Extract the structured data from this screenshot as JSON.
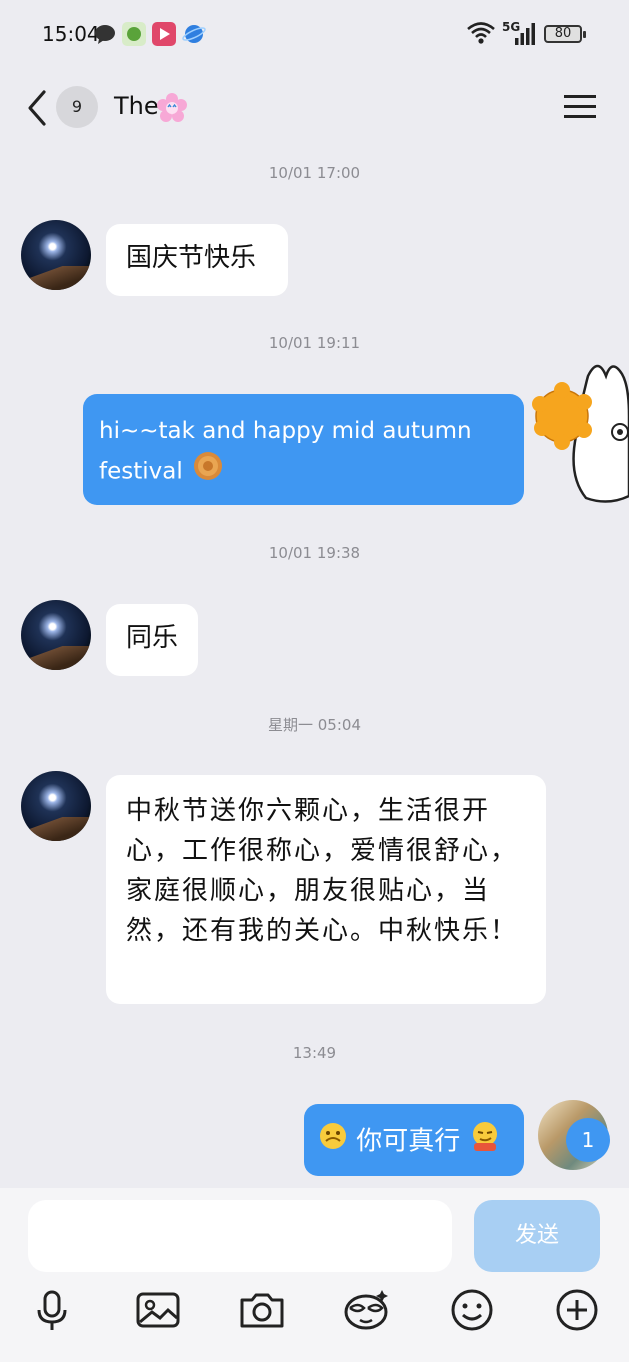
{
  "status_bar": {
    "time": "15:04",
    "network": "5G",
    "battery": "80"
  },
  "header": {
    "unread_count": "9",
    "title": "The"
  },
  "messages": [
    {
      "timestamp": "10/01 17:00",
      "direction": "in",
      "text": "国庆节快乐"
    },
    {
      "timestamp": "10/01 19:11",
      "direction": "out",
      "text": "hi~~tak and happy mid autumn festival"
    },
    {
      "timestamp": "10/01 19:38",
      "direction": "in",
      "text": "同乐"
    },
    {
      "timestamp": "星期一 05:04",
      "direction": "in",
      "text": "中秋节送你六颗心，生活很开心，工作很称心，爱情很舒心，家庭很顺心，朋友很贴心，当然，还有我的关心。中秋快乐！"
    },
    {
      "timestamp": "13:49",
      "direction": "out",
      "text": "你可真行"
    }
  ],
  "reply_badge": "1",
  "composer": {
    "placeholder": "",
    "send_label": "发送"
  },
  "toolbar_icons": [
    "microphone-icon",
    "image-icon",
    "camera-icon",
    "sticker-icon",
    "emoji-icon",
    "plus-icon"
  ],
  "colors": {
    "background": "#ececf1",
    "outgoing_bubble": "#3f97f2",
    "incoming_bubble": "#ffffff",
    "send_button": "#a8cff3"
  }
}
